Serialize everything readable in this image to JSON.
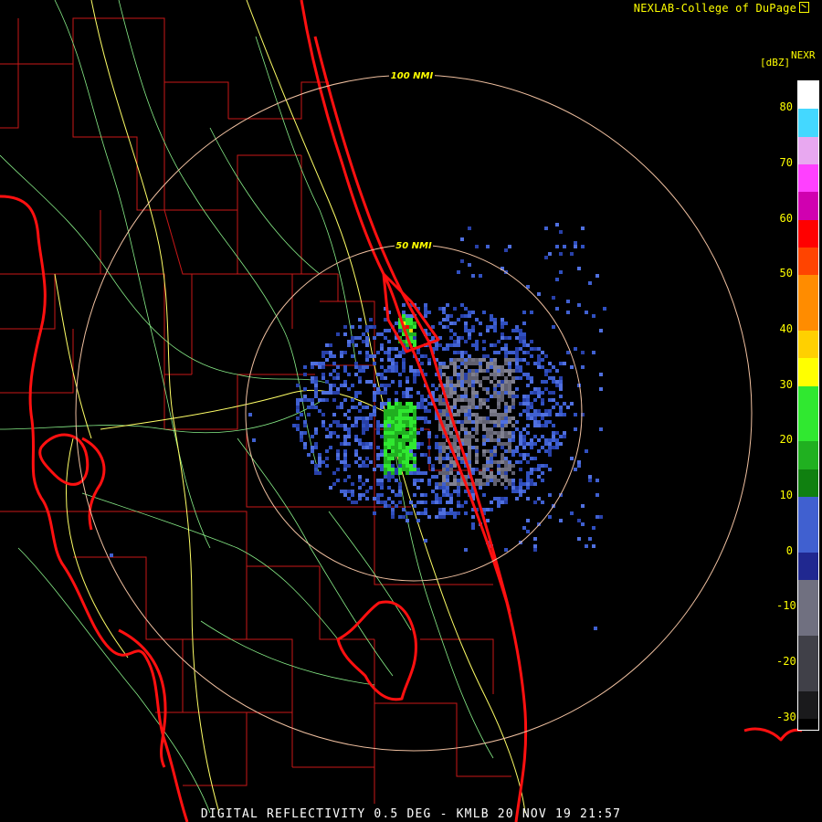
{
  "credit": "NEXLAB-College of DuPage",
  "credit_icon": "external-link-icon",
  "product": "NEXR",
  "unit": "[dBZ]",
  "caption": "DIGITAL REFLECTIVITY 0.5 DEG - KMLB 20 NOV 19 21:57",
  "range_rings": [
    {
      "label": "100 NMI",
      "range_nmi": 100
    },
    {
      "label": "50 NMI",
      "range_nmi": 50
    }
  ],
  "legend": {
    "ticks": [
      "80",
      "70",
      "60",
      "50",
      "40",
      "30",
      "20",
      "10",
      "0",
      "-10",
      "-20",
      "-30"
    ],
    "scale": [
      {
        "dbz": 85,
        "color": "#ffffff"
      },
      {
        "dbz": 80,
        "color": "#44d8ff"
      },
      {
        "dbz": 75,
        "color": "#e8a8f0"
      },
      {
        "dbz": 70,
        "color": "#ff40ff"
      },
      {
        "dbz": 65,
        "color": "#d000b0"
      },
      {
        "dbz": 60,
        "color": "#ff0000"
      },
      {
        "dbz": 55,
        "color": "#ff4400"
      },
      {
        "dbz": 50,
        "color": "#ff8c00"
      },
      {
        "dbz": 40,
        "color": "#ffd000"
      },
      {
        "dbz": 35,
        "color": "#ffff00"
      },
      {
        "dbz": 30,
        "color": "#30e830"
      },
      {
        "dbz": 20,
        "color": "#20b020"
      },
      {
        "dbz": 15,
        "color": "#108010"
      },
      {
        "dbz": 10,
        "color": "#4060d0"
      },
      {
        "dbz": 0,
        "color": "#202890"
      },
      {
        "dbz": -5,
        "color": "#707080"
      },
      {
        "dbz": -15,
        "color": "#404048"
      },
      {
        "dbz": -25,
        "color": "#1a1a1c"
      },
      {
        "dbz": -30,
        "color": "#000000"
      }
    ]
  },
  "colors": {
    "coast": "#ff1010",
    "county": "#c81818",
    "highway": "#ffff66",
    "road": "#88ee88",
    "ring": "#f0c0a0",
    "label": "#ffff00"
  }
}
